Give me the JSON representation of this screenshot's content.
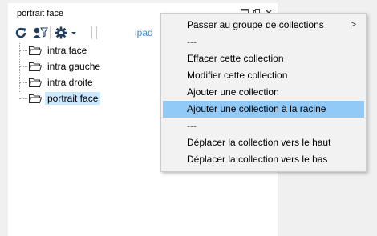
{
  "panel": {
    "title": "portrait face",
    "toolbar": {
      "device_label": "ipad"
    }
  },
  "tree": {
    "items": [
      {
        "label": "intra face"
      },
      {
        "label": "intra gauche"
      },
      {
        "label": "intra droite"
      },
      {
        "label": "portrait face",
        "selected": true
      }
    ]
  },
  "context_menu": {
    "items": [
      {
        "label": "Passer au groupe de collections",
        "submenu": true
      },
      {
        "label": "---"
      },
      {
        "label": "Effacer cette collection"
      },
      {
        "label": "Modifier cette collection"
      },
      {
        "label": "Ajouter une collection"
      },
      {
        "label": "Ajouter une collection à la racine",
        "highlighted": true
      },
      {
        "label": "---"
      },
      {
        "label": "Déplacer la collection vers le haut"
      },
      {
        "label": "Déplacer la collection vers le bas"
      }
    ],
    "submenu_arrow": ">"
  },
  "colors": {
    "menu_highlight": "#91c9f7",
    "tree_selection": "#cce8ff",
    "toolbar_link": "#3c8fd4"
  }
}
